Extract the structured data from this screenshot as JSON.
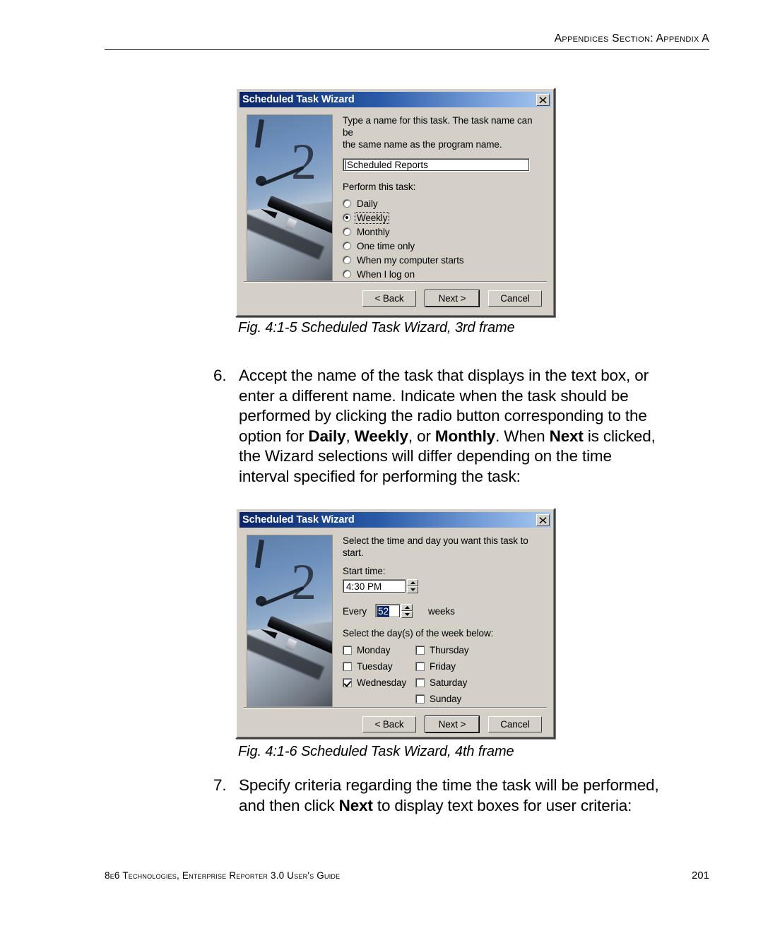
{
  "page": {
    "header": "Appendices Section: Appendix A",
    "footer_left": "8e6 Technologies, Enterprise Reporter 3.0 User's Guide",
    "footer_page": "201"
  },
  "steps": [
    {
      "number": "6.",
      "text_parts": [
        {
          "t": "Accept the name of the task that displays in the text box, or enter a different name. Indicate when the task should be performed by clicking the radio button corresponding to the option for ",
          "b": false
        },
        {
          "t": "Daily",
          "b": true
        },
        {
          "t": ", ",
          "b": false
        },
        {
          "t": "Weekly",
          "b": true
        },
        {
          "t": ", or ",
          "b": false
        },
        {
          "t": "Monthly",
          "b": true
        },
        {
          "t": ". When ",
          "b": false
        },
        {
          "t": "Next",
          "b": true
        },
        {
          "t": " is clicked, the Wizard selections will differ depending on the time interval specified for performing the task:",
          "b": false
        }
      ]
    },
    {
      "number": "7.",
      "text_parts": [
        {
          "t": "Specify criteria regarding the time the task will be performed, and then click ",
          "b": false
        },
        {
          "t": "Next",
          "b": true
        },
        {
          "t": " to display text boxes for user criteria:",
          "b": false
        }
      ]
    }
  ],
  "captions": {
    "fig1": "Fig. 4:1-5  Scheduled Task Wizard, 3rd frame",
    "fig2": "Fig. 4:1-6  Scheduled Task Wizard, 4th frame"
  },
  "dialog1": {
    "title": "Scheduled Task Wizard",
    "close_icon": "close-icon",
    "instruction_line1": "Type a name for this task.  The task name can be",
    "instruction_line2": "the same name as the program name.",
    "task_name_value": "Scheduled Reports",
    "perform_label": "Perform this task:",
    "radios": [
      {
        "label": "Daily",
        "checked": false,
        "focused": false
      },
      {
        "label": "Weekly",
        "checked": true,
        "focused": true
      },
      {
        "label": "Monthly",
        "checked": false,
        "focused": false
      },
      {
        "label": "One time only",
        "checked": false,
        "focused": false
      },
      {
        "label": "When my computer starts",
        "checked": false,
        "focused": false
      },
      {
        "label": "When I log on",
        "checked": false,
        "focused": false
      }
    ],
    "buttons": {
      "back": "< Back",
      "next": "Next >",
      "cancel": "Cancel"
    }
  },
  "dialog2": {
    "title": "Scheduled Task Wizard",
    "close_icon": "close-icon",
    "instruction": "Select the time and day you want this task to start.",
    "start_time_label": "Start time:",
    "start_time_value": "4:30 PM",
    "every_label": "Every",
    "every_value": "52",
    "weeks_label": "weeks",
    "days_label": "Select the day(s) of the week below:",
    "days_col1": [
      {
        "label": "Monday",
        "checked": false
      },
      {
        "label": "Tuesday",
        "checked": false
      },
      {
        "label": "Wednesday",
        "checked": true
      }
    ],
    "days_col2": [
      {
        "label": "Thursday",
        "checked": false
      },
      {
        "label": "Friday",
        "checked": false
      },
      {
        "label": "Saturday",
        "checked": false
      },
      {
        "label": "Sunday",
        "checked": false
      }
    ],
    "buttons": {
      "back": "< Back",
      "next": "Next >",
      "cancel": "Cancel"
    }
  },
  "colors": {
    "title_start": "#0a246a",
    "title_end": "#a6caf0",
    "dialog_face": "#d4d0c8",
    "selection": "#0a246a"
  }
}
